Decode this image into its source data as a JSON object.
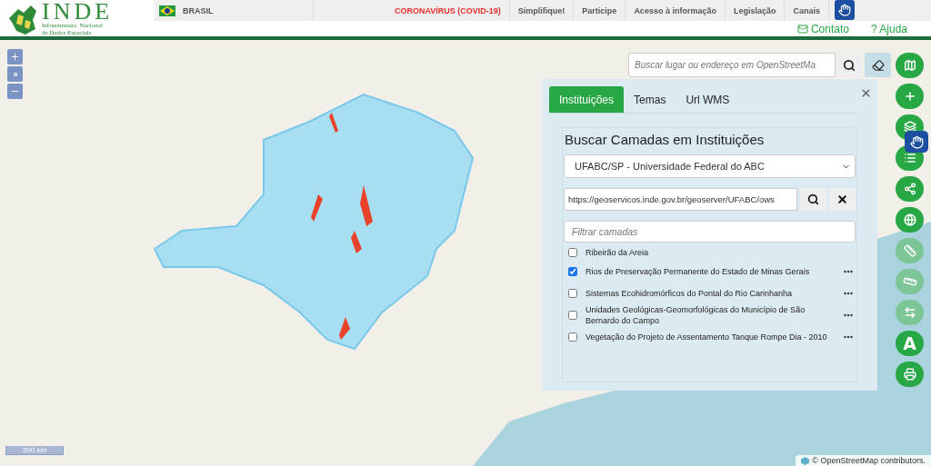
{
  "header": {
    "logo": {
      "title": "INDE",
      "subtitle_lines": [
        "Infraestrutura  Nacional",
        "de Dados Espaciais"
      ]
    },
    "gov_bar": [
      {
        "label": "BRASIL",
        "kind": "country"
      },
      {
        "label": "CORONAVÍRUS (COVID-19)",
        "kind": "alert"
      },
      {
        "label": "Simplifique!",
        "kind": "link"
      },
      {
        "label": "Participe",
        "kind": "link"
      },
      {
        "label": "Acesso à informação",
        "kind": "link"
      },
      {
        "label": "Legislação",
        "kind": "link"
      },
      {
        "label": "Canais",
        "kind": "link"
      }
    ],
    "links": [
      {
        "label": "Contato",
        "kind": "mail"
      },
      {
        "label": "? Ajuda",
        "kind": "help"
      }
    ]
  },
  "map": {
    "scale": "200 km",
    "attribution": "© OpenStreetMap contributors."
  },
  "search": {
    "placeholder": "Buscar lugar ou endereço em OpenStreetMa"
  },
  "tools": [
    {
      "kind": "map",
      "disabled": false
    },
    {
      "kind": "add",
      "disabled": false
    },
    {
      "kind": "layers",
      "disabled": false
    },
    {
      "kind": "list",
      "disabled": false
    },
    {
      "kind": "share",
      "disabled": false
    },
    {
      "kind": "globe",
      "disabled": false
    },
    {
      "kind": "ruler",
      "disabled": true
    },
    {
      "kind": "measure",
      "disabled": true
    },
    {
      "kind": "swap",
      "disabled": true
    },
    {
      "kind": "text",
      "label": "A",
      "disabled": false
    },
    {
      "kind": "print",
      "disabled": false
    }
  ],
  "panel": {
    "tabs": [
      {
        "label": "Instituições",
        "selected": true
      },
      {
        "label": "Temas",
        "selected": false
      },
      {
        "label": "Url WMS",
        "selected": false
      }
    ],
    "title": "Buscar Camadas em Instituições",
    "institution": "UFABC/SP - Universidade Federal do ABC",
    "url": "https://geoservicos.inde.gov.br/geoserver/UFABC/ows",
    "filter_placeholder": "Filtrar camadas",
    "layers": [
      {
        "label": "Ribeirão da Areia",
        "checked": false,
        "menu": false
      },
      {
        "label": "Rios de Preservação Permanente do Estado de Minas Gerais",
        "checked": true,
        "menu": true
      },
      {
        "label": "Sistemas Ecohidromórficos do Pontal do Rio Carinhanha",
        "checked": false,
        "menu": true
      },
      {
        "label": "Unidades Geológicas-Geomorfológicas do Município de São Bernardo do Campo",
        "checked": false,
        "menu": true
      },
      {
        "label": "Vegetação do Projeto de Assentamento Tanque Rompe Dia - 2010",
        "checked": false,
        "menu": true
      }
    ]
  }
}
